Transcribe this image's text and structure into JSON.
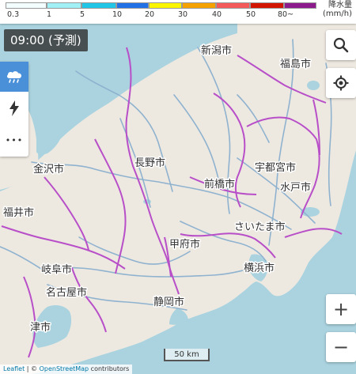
{
  "legend": {
    "title": "降水量",
    "unit": "(mm/h)",
    "ticks": [
      "0.3",
      "1",
      "5",
      "10",
      "20",
      "30",
      "40",
      "50",
      "80~"
    ],
    "colors": [
      "#f2feff",
      "#a0f0f5",
      "#21c5e6",
      "#2170e6",
      "#faf500",
      "#f5a100",
      "#f55a5a",
      "#d21500",
      "#8c1c8c"
    ]
  },
  "time_badge": "09:00 (予測)",
  "cities": [
    {
      "name": "新潟市"
    },
    {
      "name": "福島市"
    },
    {
      "name": "長野市"
    },
    {
      "name": "宇都宮市"
    },
    {
      "name": "金沢市"
    },
    {
      "name": "前橋市"
    },
    {
      "name": "水戸市"
    },
    {
      "name": "福井市"
    },
    {
      "name": "さいたま市"
    },
    {
      "name": "甲府市"
    },
    {
      "name": "岐阜市"
    },
    {
      "name": "横浜市"
    },
    {
      "name": "名古屋市"
    },
    {
      "name": "静岡市"
    },
    {
      "name": "津市"
    }
  ],
  "controls": {
    "zoom_in": "+",
    "zoom_out": "−"
  },
  "layers": {
    "rain_icon": "rain-cloud-icon",
    "lightning_icon": "lightning-icon",
    "more_icon": "more-icon",
    "more_glyph": "•••"
  },
  "scale_label": "50 km",
  "attribution": {
    "leaflet": "Leaflet",
    "separator": " | © ",
    "osm": "OpenStreetMap",
    "suffix": " contributors"
  },
  "colors": {
    "sea": "#aad3df",
    "land": "#ede9e1",
    "boundary": "#b84fc8",
    "road": "#8fb2cf",
    "active_layer": "#4a90d9"
  }
}
